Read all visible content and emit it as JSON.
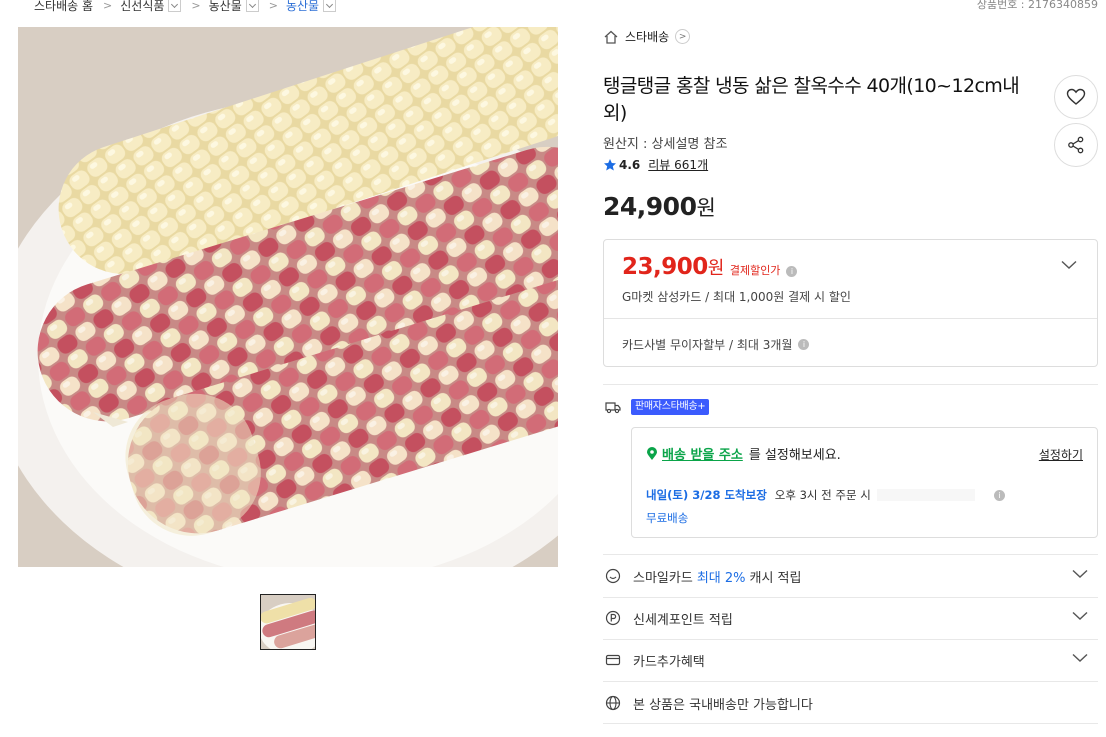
{
  "breadcrumb": {
    "items": [
      {
        "label": "스타배송 홈"
      },
      {
        "label": "신선식품"
      },
      {
        "label": "농산물"
      },
      {
        "label": "농산물"
      }
    ]
  },
  "item_number": "상품번호 : 2176340859",
  "shop": {
    "name": "스타배송"
  },
  "product": {
    "title": "탱글탱글 홍찰 냉동 삶은 찰옥수수 40개(10~12cm내외)",
    "origin": "원산지 : 상세설명 참조",
    "rating": "4.6",
    "review": "리뷰 661개",
    "price": "24,900",
    "price_unit": "원"
  },
  "discount": {
    "price": "23,900",
    "price_unit": "원",
    "label": "결제할인가",
    "card_text": "G마켓 삼성카드 / 최대 1,000원 결제 시 할인",
    "installment": "카드사별 무이자할부 / 최대 3개월"
  },
  "delivery": {
    "badge": "판매자스타배송+",
    "address_link": "배송 받을 주소",
    "address_suffix": "를 설정해보세요.",
    "set_button": "설정하기",
    "arrival": "내일(토) 3/28 도착보장",
    "order_deadline": "오후 3시 전 주문 시",
    "free_shipping": "무료배송"
  },
  "benefits": [
    {
      "prefix": "스마일카드",
      "highlight": "최대 2%",
      "suffix": "캐시 적립",
      "icon": "smile-card-icon"
    },
    {
      "prefix": "신세계포인트 적립",
      "highlight": "",
      "suffix": "",
      "icon": "point-icon"
    },
    {
      "prefix": "카드추가혜택",
      "highlight": "",
      "suffix": "",
      "icon": "card-icon"
    },
    {
      "prefix": "본 상품은 국내배송만 가능합니다",
      "highlight": "",
      "suffix": "",
      "icon": "globe-icon"
    }
  ],
  "colors": {
    "accent_red": "#e1251b",
    "link_blue": "#1c6de4",
    "green": "#0aa449",
    "badge_blue": "#3b5bfd"
  }
}
